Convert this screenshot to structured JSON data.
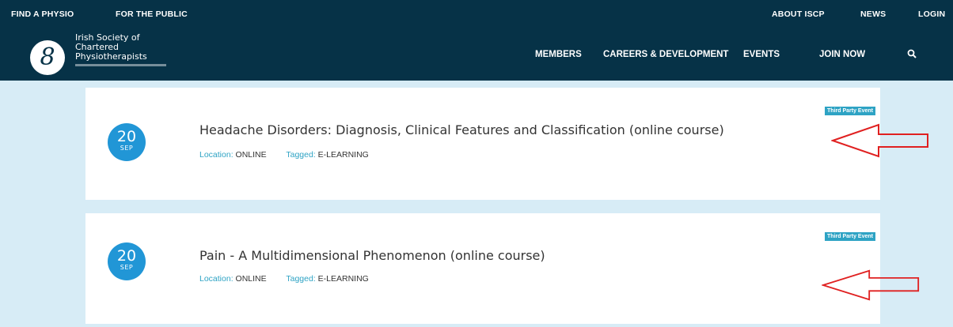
{
  "top_nav": {
    "find_physio": "FIND A PHYSIO",
    "for_public": "FOR THE PUBLIC",
    "about": "ABOUT ISCP",
    "news": "NEWS",
    "login": "LOGIN"
  },
  "brand": {
    "logo_glyph": "8",
    "line1": "Irish Society of",
    "line2": "Chartered",
    "line3": "Physiotherapists"
  },
  "main_nav": {
    "members": "MEMBERS",
    "careers": "CAREERS & DEVELOPMENT",
    "events": "EVENTS",
    "join": "JOIN NOW",
    "search_icon": "search-icon"
  },
  "events": [
    {
      "badge": "Third Party Event",
      "day": "20",
      "month": "SEP",
      "title": "Headache Disorders: Diagnosis, Clinical Features and Classification (online course)",
      "location_label": "Location:",
      "location": "ONLINE",
      "tagged_label": "Tagged:",
      "tag": "E-LEARNING"
    },
    {
      "badge": "Third Party Event",
      "day": "20",
      "month": "SEP",
      "title": "Pain - A Multidimensional Phenomenon (online course)",
      "location_label": "Location:",
      "location": "ONLINE",
      "tagged_label": "Tagged:",
      "tag": "E-LEARNING"
    }
  ],
  "colors": {
    "nav_bg": "#063247",
    "page_bg": "#d7ecf6",
    "date_circle": "#2196d6",
    "accent": "#2ea3c4",
    "annotation_arrow": "#e02020"
  }
}
